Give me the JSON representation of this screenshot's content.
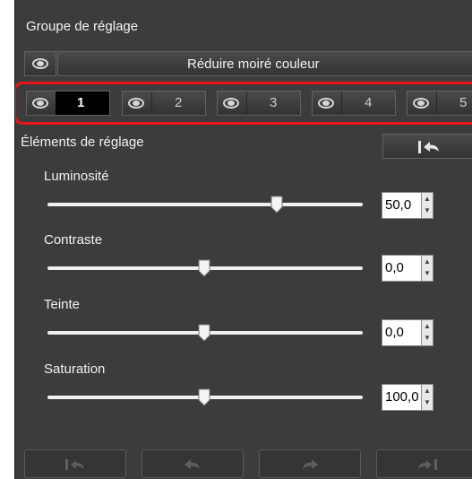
{
  "group": {
    "title": "Groupe de réglage",
    "preset_name": "Réduire moiré couleur"
  },
  "tabs": [
    {
      "label": "1",
      "active": true
    },
    {
      "label": "2",
      "active": false
    },
    {
      "label": "3",
      "active": false
    },
    {
      "label": "4",
      "active": false
    },
    {
      "label": "5",
      "active": false
    }
  ],
  "elements": {
    "title": "Éléments de réglage",
    "sliders": [
      {
        "label": "Luminosité",
        "value": "50,0",
        "position": 0.75
      },
      {
        "label": "Contraste",
        "value": "0,0",
        "position": 0.5
      },
      {
        "label": "Teinte",
        "value": "0,0",
        "position": 0.5
      },
      {
        "label": "Saturation",
        "value": "100,0",
        "position": 0.5
      }
    ]
  },
  "colors": {
    "highlight": "#e8151b",
    "panel_bg": "#3c3c3c",
    "active_tab": "#000000"
  },
  "icons": [
    "eye-icon",
    "reset-arrow-icon",
    "undo-icon",
    "redo-icon",
    "go-last-icon",
    "go-first-icon"
  ]
}
